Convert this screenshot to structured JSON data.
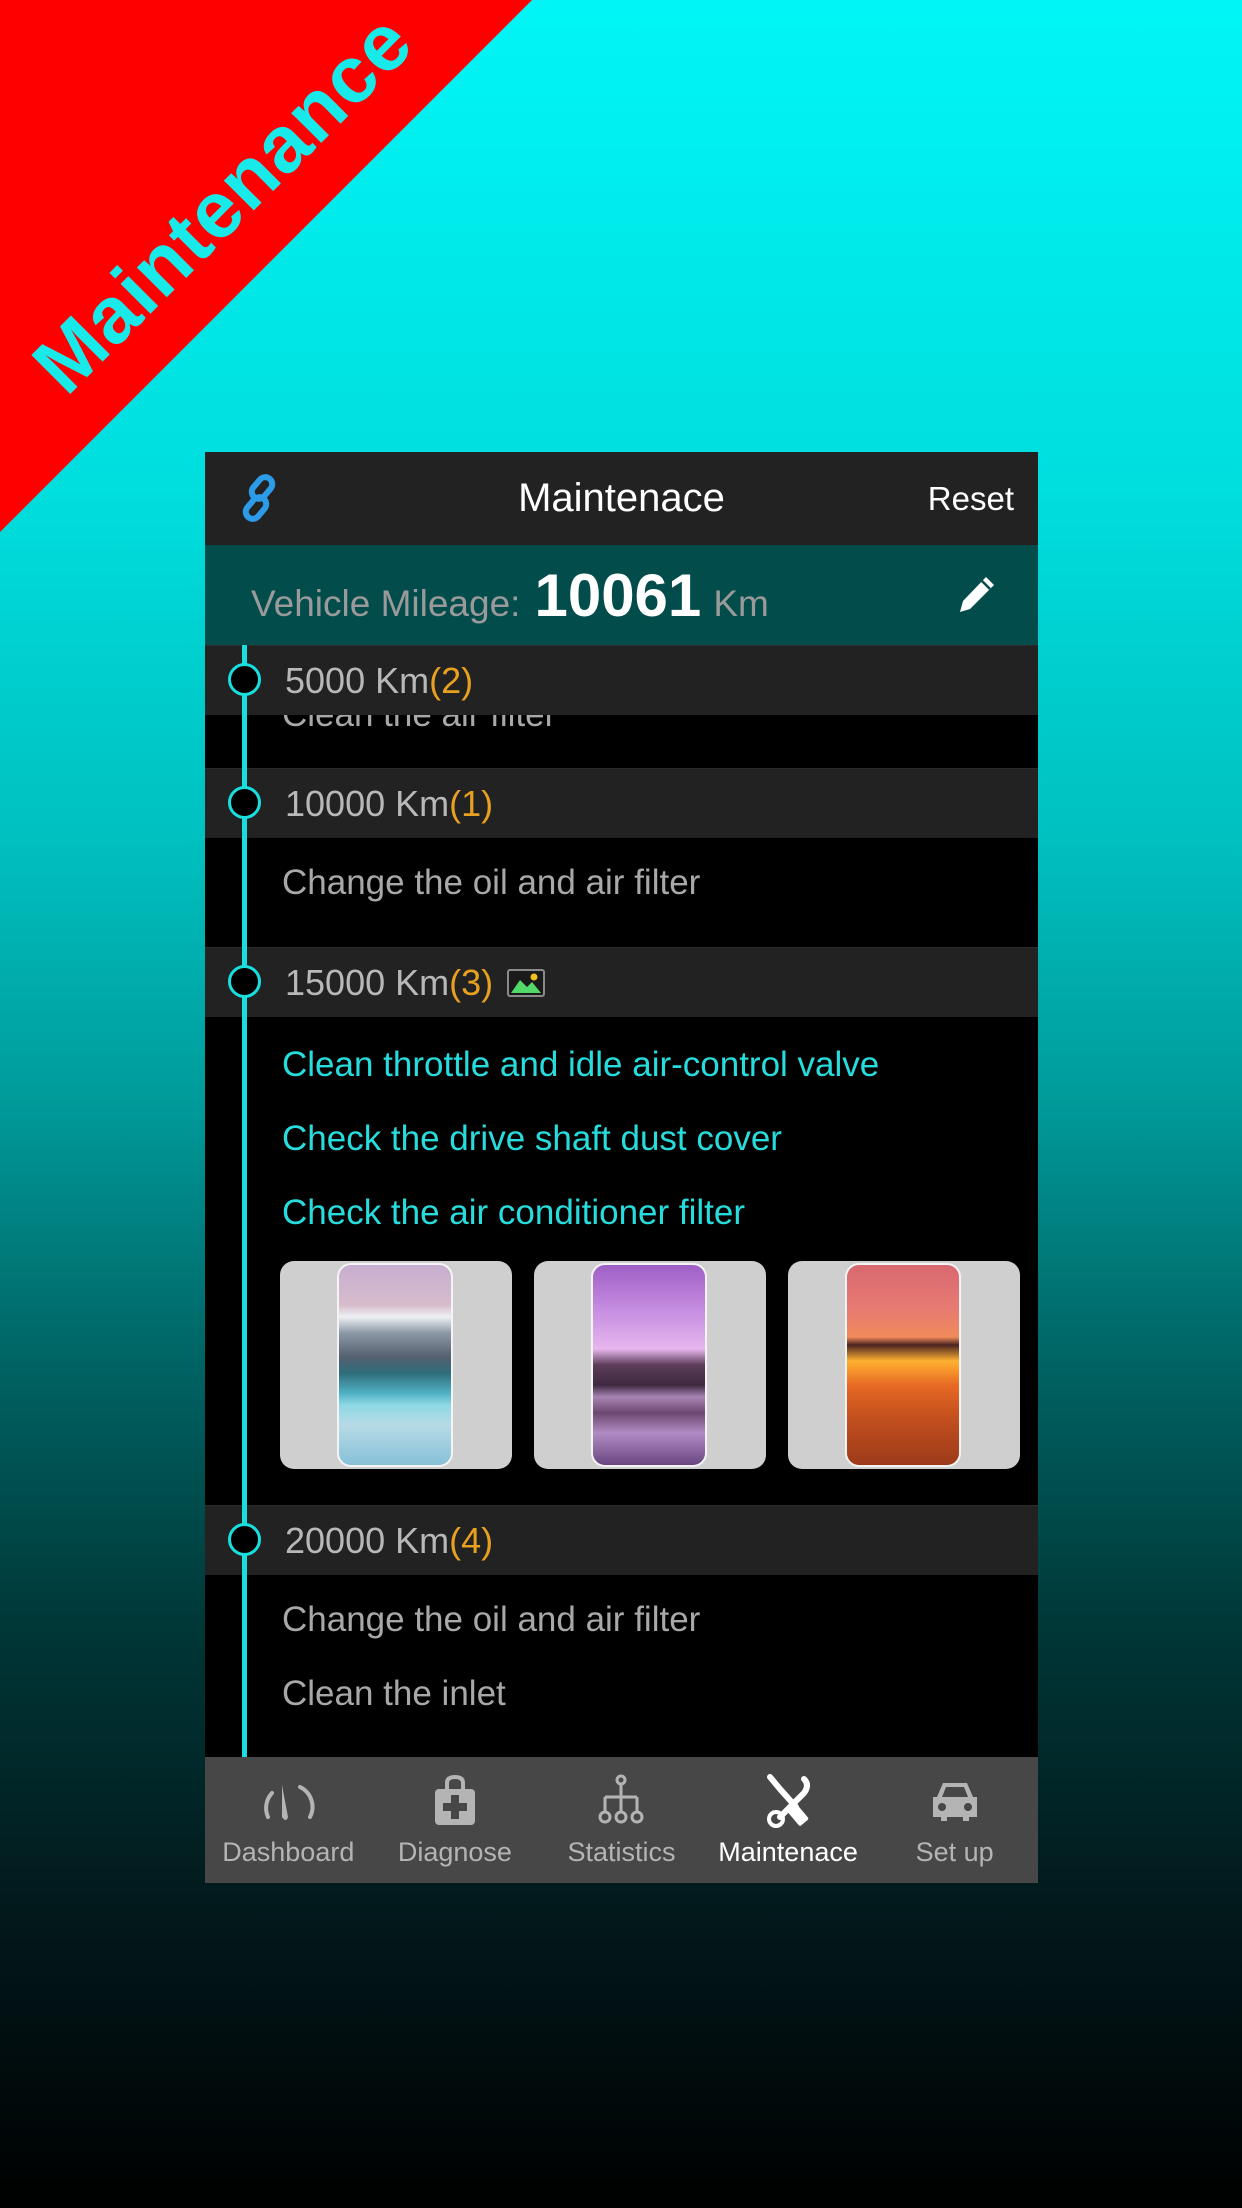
{
  "promo": {
    "ribbon_text": "Maintenance",
    "ribbon_color": "#ff0000",
    "text_color": "#18eaea"
  },
  "header": {
    "title": "Maintenace",
    "left_icon": "link-icon",
    "reset_label": "Reset"
  },
  "mileage": {
    "label": "Vehicle Mileage:",
    "value": "10061",
    "unit": "Km",
    "edit_icon": "pencil-icon"
  },
  "colors": {
    "accent": "#19dede",
    "count": "#e8a020",
    "mileage_bg": "#034c4c",
    "header_bg": "#222222",
    "nav_bg": "#474747"
  },
  "sections": [
    {
      "km": "5000 Km",
      "count": "(2)",
      "has_image": false,
      "tasks": [
        "Clean the air filter"
      ]
    },
    {
      "km": "10000 Km",
      "count": "(1)",
      "has_image": false,
      "tasks": [
        "Change the oil and air filter"
      ]
    },
    {
      "km": "15000 Km",
      "count": "(3)",
      "has_image": true,
      "image_icon": "image-icon",
      "tasks": [
        "Clean throttle and idle air-control valve",
        "Check the drive shaft dust cover",
        "Check the air conditioner filter"
      ],
      "photos": [
        {
          "name": "mountain-lake-photo"
        },
        {
          "name": "purple-lake-photo"
        },
        {
          "name": "sunset-pier-photo"
        }
      ]
    },
    {
      "km": "20000 Km",
      "count": "(4)",
      "has_image": false,
      "tasks": [
        "Change the oil and air filter",
        "Clean the inlet"
      ]
    }
  ],
  "nav": [
    {
      "label": "Dashboard",
      "icon": "gauge-icon",
      "active": false
    },
    {
      "label": "Diagnose",
      "icon": "medical-kit-icon",
      "active": false
    },
    {
      "label": "Statistics",
      "icon": "hierarchy-icon",
      "active": false
    },
    {
      "label": "Maintenace",
      "icon": "wrench-screwdriver-icon",
      "active": true
    },
    {
      "label": "Set up",
      "icon": "car-icon",
      "active": false
    }
  ]
}
